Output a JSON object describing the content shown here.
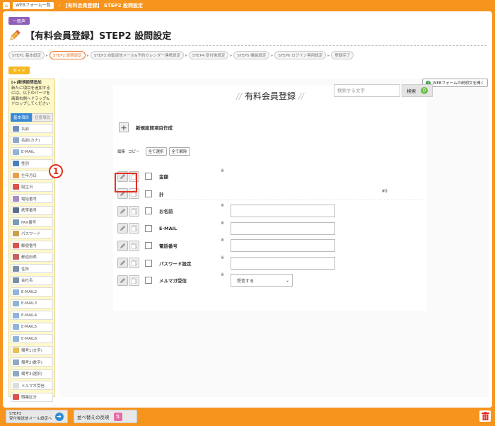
{
  "topbar": {
    "crumb1": "WEBフォーム一覧",
    "current": "【有料会員登録】 STEP2 設問設定"
  },
  "header": {
    "badge": "一般声",
    "title": "【有料会員登録】STEP2 設問設定"
  },
  "steps": [
    {
      "label": "STEP1 基本設定"
    },
    {
      "label": "STEP2 設問設定"
    },
    {
      "label": "STEP3 自動返信メール&予約カレンダー連携設定"
    },
    {
      "label": "STEP4 受付後設定"
    },
    {
      "label": "STEP5 機能設定"
    },
    {
      "label": "STEP6 ログイン専用設定"
    },
    {
      "label": "登録完了"
    }
  ],
  "guide_label": "ガイド",
  "sidebar": {
    "info_lines": [
      "[+]新規設問追加",
      "新たに項目を追加する",
      "には、以下のパーツを",
      "画面右側へドラッグ&",
      "ドロップしてください"
    ],
    "tab_basic": "基本項目",
    "tab_other": "任意項目",
    "items": [
      {
        "label": "名前",
        "icon": "name-card-icon",
        "color": "#6c8ebf"
      },
      {
        "label": "名前(カナ)",
        "icon": "name-kana-icon",
        "color": "#8fa8c8"
      },
      {
        "label": "E-MAIL",
        "icon": "mail-icon",
        "color": "#8fb3d9"
      },
      {
        "label": "性別",
        "icon": "gender-icon",
        "color": "#4a7fc0"
      },
      {
        "label": "生年月日",
        "icon": "birthday-icon",
        "color": "#e8a046"
      },
      {
        "label": "誕生日",
        "icon": "calendar-icon",
        "color": "#d9534f"
      },
      {
        "label": "電話番号",
        "icon": "phone-icon",
        "color": "#a98bc4"
      },
      {
        "label": "携帯番号",
        "icon": "mobile-icon",
        "color": "#5a6f8c"
      },
      {
        "label": "FAX番号",
        "icon": "fax-icon",
        "color": "#7a9ab8"
      },
      {
        "label": "パスワード",
        "icon": "lock-icon",
        "color": "#c8a050"
      },
      {
        "label": "郵便番号",
        "icon": "postal-icon",
        "color": "#d9534f"
      },
      {
        "label": "都道府県",
        "icon": "prefecture-icon",
        "color": "#c86060"
      },
      {
        "label": "住所",
        "icon": "house-icon",
        "color": "#7a8fa8"
      },
      {
        "label": "会社名",
        "icon": "building-icon",
        "color": "#7a8fa8"
      },
      {
        "label": "E-MAIL2",
        "icon": "mail-icon",
        "color": "#8fb3d9"
      },
      {
        "label": "E-MAIL3",
        "icon": "mail-icon",
        "color": "#8fb3d9"
      },
      {
        "label": "E-MAIL4",
        "icon": "mail-icon",
        "color": "#8fb3d9"
      },
      {
        "label": "E-MAIL5",
        "icon": "mail-icon",
        "color": "#8fb3d9"
      },
      {
        "label": "E-MAIL6",
        "icon": "mail-icon",
        "color": "#8fb3d9"
      },
      {
        "label": "備考1(文字)",
        "icon": "note-icon",
        "color": "#e8c050"
      },
      {
        "label": "備考2(数字)",
        "icon": "note-icon",
        "color": "#8fa8c8"
      },
      {
        "label": "備考3(選択)",
        "icon": "note-icon",
        "color": "#8fa8c8"
      },
      {
        "label": "メルマガ受信",
        "icon": "newsletter-icon",
        "color": "#dddddd"
      },
      {
        "label": "職業区分",
        "icon": "job-icon",
        "color": "#d9534f"
      }
    ]
  },
  "main": {
    "desc_button": "WEBフォームの説明文を開く",
    "form_title": "有料会員登録",
    "search_placeholder": "検索する文字",
    "search_button": "検索",
    "new_item": "新規設問項目作成",
    "edit_label": "編集",
    "copy_label": "コピー",
    "select_all": "全て選択",
    "deselect_all": "全て解除",
    "questions": [
      {
        "label": "金額",
        "required": "※",
        "type": "none"
      },
      {
        "label": "計",
        "required": "",
        "type": "total",
        "note": "¥0"
      },
      {
        "label": "お名前",
        "required": "※",
        "type": "input"
      },
      {
        "label": "E-MAIL",
        "required": "※",
        "type": "input"
      },
      {
        "label": "電話番号",
        "required": "※",
        "type": "input"
      },
      {
        "label": "パスワード設定",
        "required": "※",
        "type": "input"
      },
      {
        "label": "メルマガ受信",
        "required": "※",
        "type": "select",
        "value": "受信する"
      }
    ],
    "callout": "1"
  },
  "bottom": {
    "next_line1": "STEP3",
    "next_line2": "受付後送信メール設定へ",
    "reorder": "並べ替えの反映"
  },
  "colors": {
    "brand": "#f7941d",
    "active_step": "#e8742a",
    "callout": "#e0301e"
  }
}
